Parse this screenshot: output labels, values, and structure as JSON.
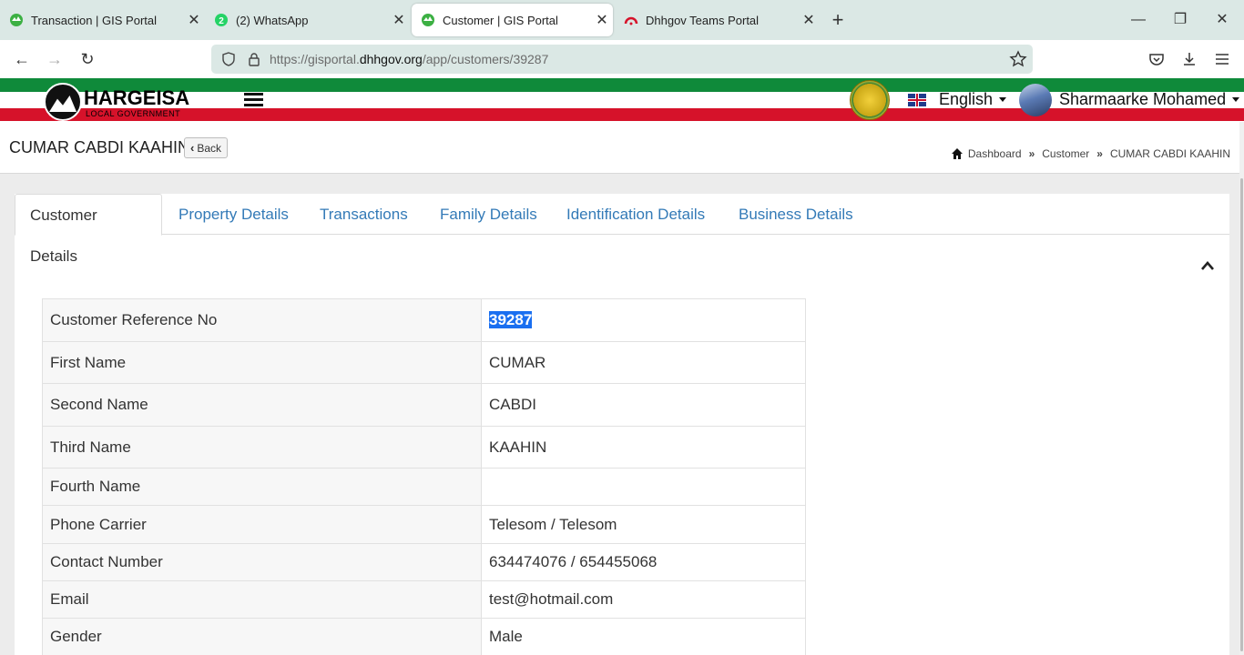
{
  "browser": {
    "tabs": [
      {
        "title": "Transaction | GIS Portal",
        "icon": "gis-portal-icon"
      },
      {
        "title": "(2) WhatsApp",
        "icon": "whatsapp-icon",
        "badge": "2"
      },
      {
        "title": "Customer | GIS Portal",
        "icon": "gis-portal-icon",
        "active": true
      },
      {
        "title": "Dhhgov Teams Portal",
        "icon": "teams-portal-icon"
      }
    ],
    "url_prefix": "https://gisportal.",
    "url_host": "dhhgov.org",
    "url_path": "/app/customers/39287"
  },
  "header": {
    "logo_text": "HARGEISA",
    "logo_sub": "LOCAL GOVERNMENT",
    "logo_mark": "DHH",
    "language": "English",
    "user_name": "Sharmaarke Mohamed",
    "colors": {
      "green": "#0f8a3a",
      "red": "#d6122a"
    }
  },
  "page": {
    "title": "CUMAR CABDI KAAHIN",
    "back_label": "Back",
    "breadcrumb": [
      "Dashboard",
      "Customer",
      "CUMAR CABDI KAAHIN"
    ]
  },
  "tabs": [
    {
      "label": "Customer Details",
      "active": true
    },
    {
      "label": "Property Details"
    },
    {
      "label": "Transactions"
    },
    {
      "label": "Family Details"
    },
    {
      "label": "Identification Details"
    },
    {
      "label": "Business Details"
    }
  ],
  "details": [
    {
      "label": "Customer Reference No",
      "value": "39287"
    },
    {
      "label": "First Name",
      "value": "CUMAR"
    },
    {
      "label": "Second Name",
      "value": "CABDI"
    },
    {
      "label": "Third Name",
      "value": "KAAHIN"
    },
    {
      "label": "Fourth Name",
      "value": ""
    },
    {
      "label": "Phone Carrier",
      "value": "Telesom / Telesom"
    },
    {
      "label": "Contact Number",
      "value": "634474076 / 654455068"
    },
    {
      "label": "Email",
      "value": "test@hotmail.com"
    },
    {
      "label": "Gender",
      "value": "Male"
    }
  ]
}
